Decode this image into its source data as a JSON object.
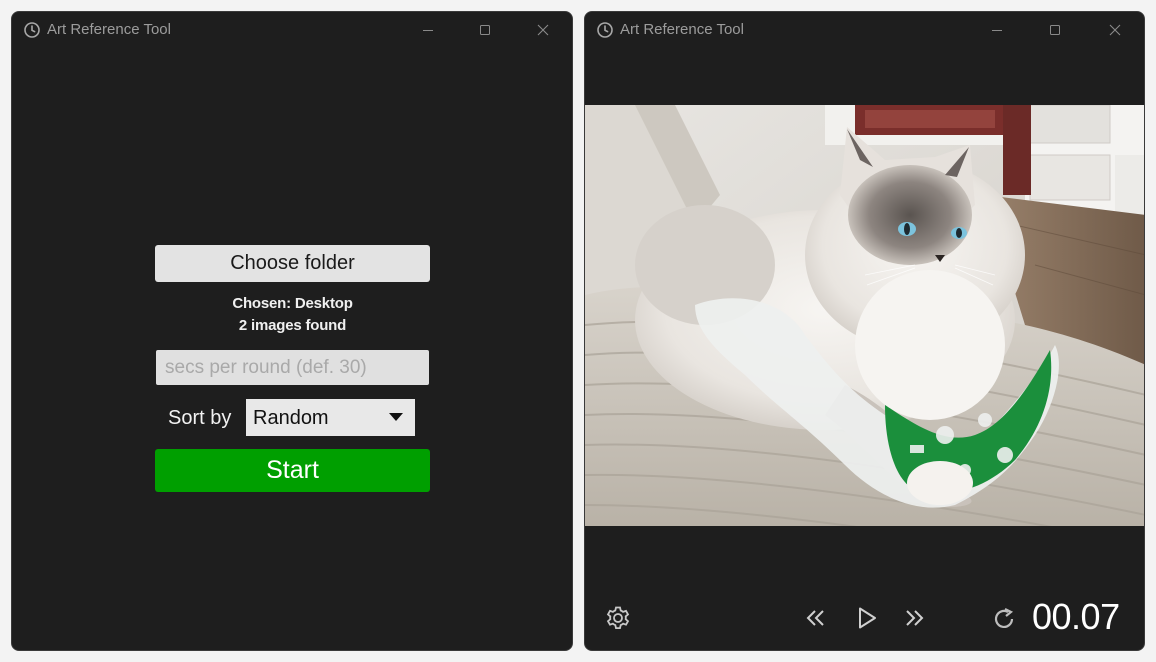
{
  "left_window": {
    "title": "Art Reference Tool",
    "choose_folder_label": "Choose folder",
    "chosen_text": "Chosen: Desktop",
    "found_text": "2 images found",
    "secs_placeholder": "secs per round (def. 30)",
    "secs_value": "",
    "sort_label": "Sort by",
    "sort_value": "Random",
    "start_label": "Start"
  },
  "right_window": {
    "title": "Art Reference Tool",
    "timer": "00.07",
    "icons": {
      "settings": "gear-icon",
      "previous": "double-chevron-left-icon",
      "play": "play-icon",
      "next": "double-chevron-right-icon",
      "restart": "restart-icon"
    }
  },
  "colors": {
    "window_bg": "#1e1e1e",
    "start_green": "#009f00",
    "button_light": "#e3e3e3",
    "title_text": "#9c9c9c"
  }
}
